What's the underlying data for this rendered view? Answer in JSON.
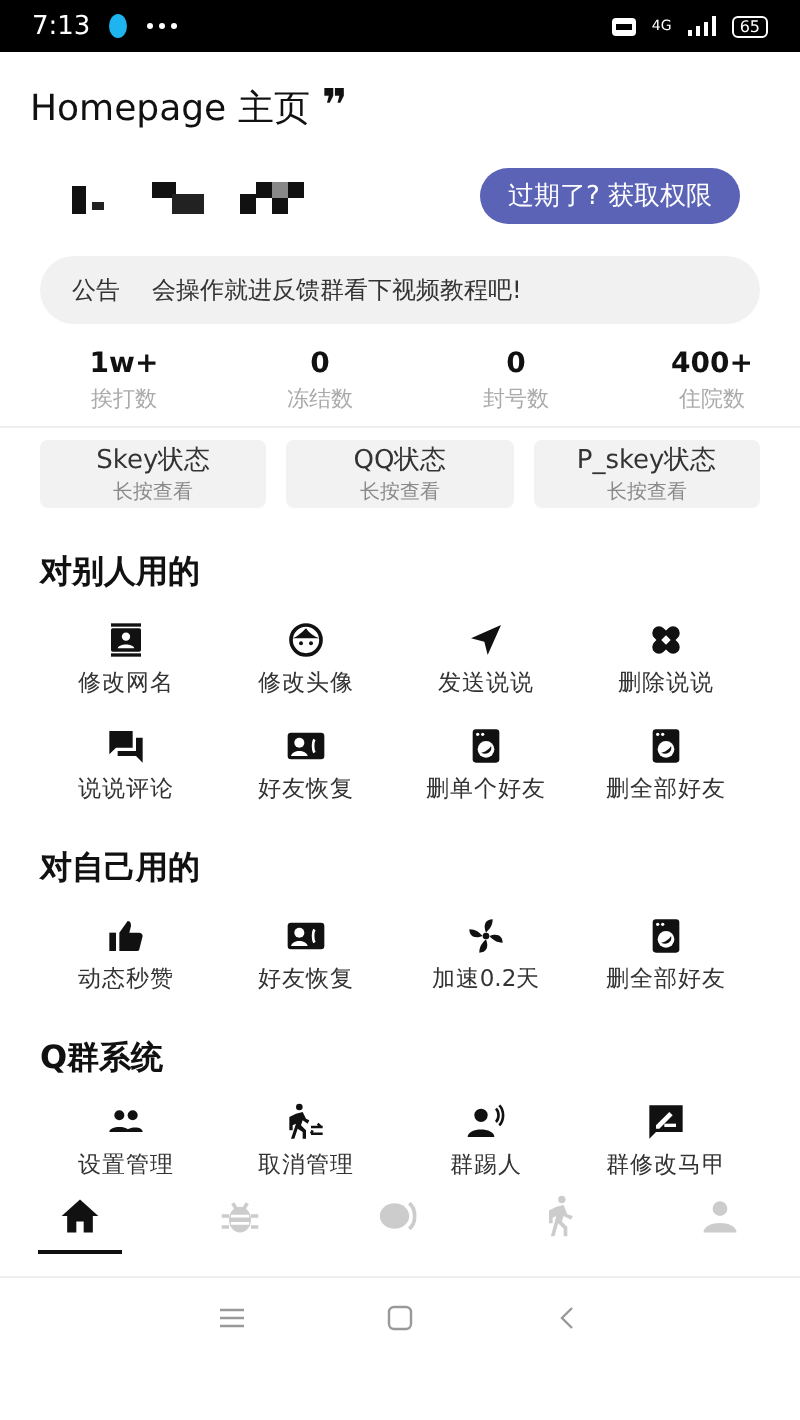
{
  "status_bar": {
    "time": "7:13",
    "network": "4G",
    "battery": "65"
  },
  "header": {
    "title": "Homepage 主页",
    "quote_mark": "❞"
  },
  "account": {
    "renew_button": "过期了? 获取权限"
  },
  "notice": {
    "label": "公告",
    "text": "会操作就进反馈群看下视频教程吧!"
  },
  "stats": [
    {
      "value": "1w+",
      "label": "挨打数"
    },
    {
      "value": "0",
      "label": "冻结数"
    },
    {
      "value": "0",
      "label": "封号数"
    },
    {
      "value": "400+",
      "label": "住院数"
    }
  ],
  "status_cards": [
    {
      "title": "Skey状态",
      "hint": "长按查看"
    },
    {
      "title": "QQ状态",
      "hint": "长按查看"
    },
    {
      "title": "P_skey状态",
      "hint": "长按查看"
    }
  ],
  "sections": [
    {
      "title": "对别人用的",
      "items": [
        "修改网名",
        "修改头像",
        "发送说说",
        "删除说说",
        "说说评论",
        "好友恢复",
        "删单个好友",
        "删全部好友"
      ]
    },
    {
      "title": "对自己用的",
      "items": [
        "动态秒赞",
        "好友恢复",
        "加速0.2天",
        "删全部好友"
      ]
    },
    {
      "title": "Q群系统",
      "items": [
        "设置管理",
        "取消管理",
        "群踢人",
        "群修改马甲"
      ]
    }
  ],
  "tabs": [
    {
      "selected": true
    },
    {
      "selected": false
    },
    {
      "selected": false
    },
    {
      "selected": false
    },
    {
      "selected": false
    }
  ]
}
